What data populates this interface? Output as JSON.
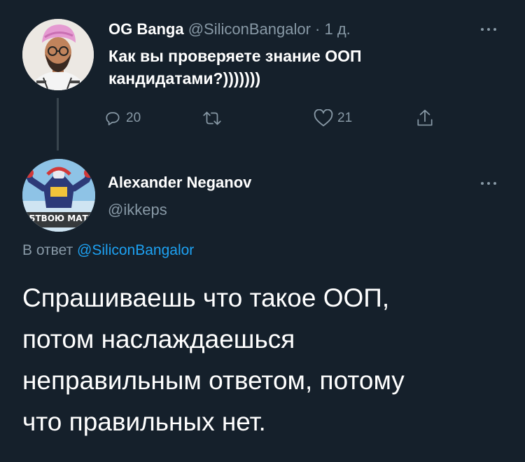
{
  "parent_tweet": {
    "author_name": "OG Banga",
    "handle": "@SiliconBangalor",
    "separator": "·",
    "time": "1 д.",
    "text_line1": "Как вы проверяете знание ООП",
    "text_line2": "кандидатами?)))))))",
    "reply_count": "20",
    "retweet_count": "",
    "like_count": "21"
  },
  "reply_tweet": {
    "author_name": "Alexander Neganov",
    "handle": "@ikkeps",
    "avatar_caption": "ЁБТВОЮ МАТЬ",
    "replying_to_label": "В ответ",
    "replying_to_handle": "@SiliconBangalor",
    "text_lines": [
      "Спрашиваешь что такое ООП,",
      "потом наслаждаешься",
      "неправильным ответом, потому",
      "что правильных нет."
    ]
  },
  "colors": {
    "background": "#15202b",
    "primary_text": "#ffffff",
    "secondary_text": "#8899a6",
    "link": "#1da1f2",
    "divider": "#38444d"
  },
  "icons": {
    "reply": "reply-bubble-icon",
    "retweet": "retweet-icon",
    "like": "heart-icon",
    "share": "share-icon",
    "more": "more-dots-icon"
  }
}
